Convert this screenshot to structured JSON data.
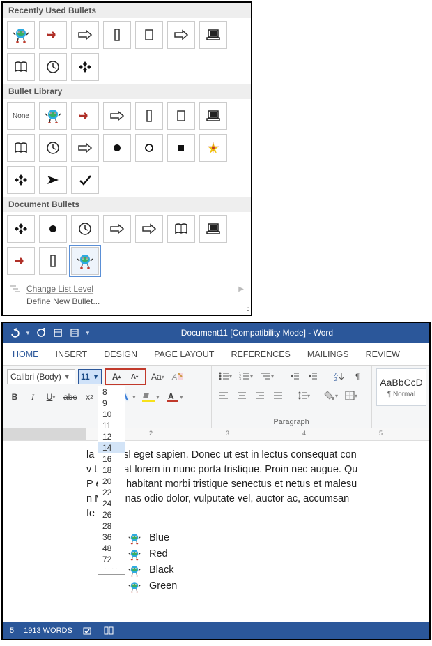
{
  "bullet_panel": {
    "sections": {
      "recent": "Recently Used Bullets",
      "library": "Bullet Library",
      "document": "Document Bullets"
    },
    "none_label": "None",
    "recent_items": [
      "globe",
      "arrow-red",
      "arrow-outline",
      "rect-tall",
      "rect-wide",
      "arrow-outline",
      "laptop",
      "book",
      "clock",
      "diamonds4"
    ],
    "library_items": [
      "none",
      "globe",
      "arrow-red",
      "arrow-outline",
      "rect-tall",
      "rect-wide",
      "laptop",
      "book",
      "clock",
      "arrow-outline",
      "disc",
      "circle",
      "square-small",
      "star-color",
      "diamonds4",
      "arrowhead",
      "check"
    ],
    "document_items": [
      "diamonds4",
      "disc",
      "clock",
      "arrow-outline",
      "arrow-outline",
      "book",
      "laptop",
      "arrow-red",
      "rect-tall",
      "globe"
    ],
    "document_selected_index": 9,
    "footer": {
      "change_level": "Change List Level",
      "define_new": "Define New Bullet..."
    }
  },
  "word": {
    "title": "Document11 [Compatibility Mode] - Word",
    "tabs": [
      "HOME",
      "INSERT",
      "DESIGN",
      "PAGE LAYOUT",
      "REFERENCES",
      "MAILINGS",
      "REVIEW"
    ],
    "active_tab": 0,
    "font_name": "Calibri (Body)",
    "font_size": "11",
    "size_options": [
      "8",
      "9",
      "10",
      "11",
      "12",
      "14",
      "16",
      "18",
      "20",
      "22",
      "24",
      "26",
      "28",
      "36",
      "48",
      "72"
    ],
    "size_highlight": "14",
    "group_labels": {
      "paragraph": "Paragraph"
    },
    "style_preview": "AaBbCcD",
    "style_name": "¶ Normal",
    "ruler_ticks": [
      "2",
      "3",
      "4",
      "5"
    ],
    "paragraph_lines": [
      "la             ulla nisl eget sapien. Donec ut est in lectus consequat con",
      "v              t. Sed at lorem in nunc porta tristique. Proin nec augue. Qu",
      "P             esque habitant morbi tristique senectus et netus et malesu",
      "n              Maecenas odio dolor, vulputate vel, auctor ac, accumsan",
      "fe"
    ],
    "list_items": [
      "Blue",
      "Red",
      "Black",
      "Green"
    ],
    "status": {
      "page_like": "5",
      "words": "1913 WORDS"
    }
  }
}
